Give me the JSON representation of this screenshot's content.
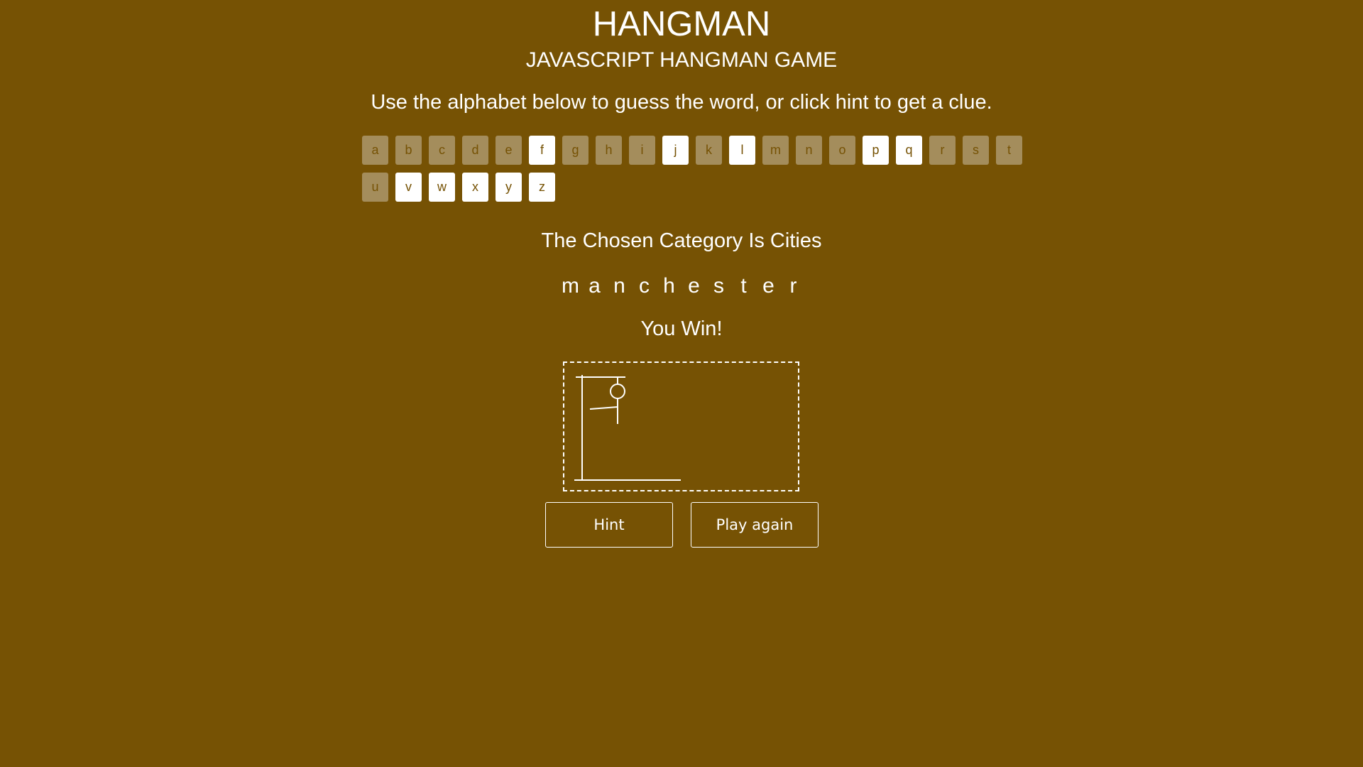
{
  "header": {
    "title": "HANGMAN",
    "subtitle": "JAVASCRIPT HANGMAN GAME",
    "instructions": "Use the alphabet below to guess the word, or click hint to get a clue."
  },
  "alphabet": [
    {
      "letter": "a",
      "used": true
    },
    {
      "letter": "b",
      "used": true
    },
    {
      "letter": "c",
      "used": true
    },
    {
      "letter": "d",
      "used": true
    },
    {
      "letter": "e",
      "used": true
    },
    {
      "letter": "f",
      "used": false
    },
    {
      "letter": "g",
      "used": true
    },
    {
      "letter": "h",
      "used": true
    },
    {
      "letter": "i",
      "used": true
    },
    {
      "letter": "j",
      "used": false
    },
    {
      "letter": "k",
      "used": true
    },
    {
      "letter": "l",
      "used": false
    },
    {
      "letter": "m",
      "used": true
    },
    {
      "letter": "n",
      "used": true
    },
    {
      "letter": "o",
      "used": true
    },
    {
      "letter": "p",
      "used": false
    },
    {
      "letter": "q",
      "used": false
    },
    {
      "letter": "r",
      "used": true
    },
    {
      "letter": "s",
      "used": true
    },
    {
      "letter": "t",
      "used": true
    },
    {
      "letter": "u",
      "used": true
    },
    {
      "letter": "v",
      "used": false
    },
    {
      "letter": "w",
      "used": false
    },
    {
      "letter": "x",
      "used": false
    },
    {
      "letter": "y",
      "used": false
    },
    {
      "letter": "z",
      "used": false
    }
  ],
  "game": {
    "category": "The Chosen Category Is Cities",
    "word": [
      "m",
      "a",
      "n",
      "c",
      "h",
      "e",
      "s",
      "t",
      "e",
      "r"
    ],
    "status": "You Win!",
    "hangman_parts_shown": [
      "gallows",
      "head",
      "body",
      "left-arm"
    ]
  },
  "buttons": {
    "hint": "Hint",
    "play_again": "Play again"
  },
  "colors": {
    "background": "#765204",
    "text": "#ffffff",
    "key_available": "#ffffff",
    "key_used": "#a48d5c"
  }
}
